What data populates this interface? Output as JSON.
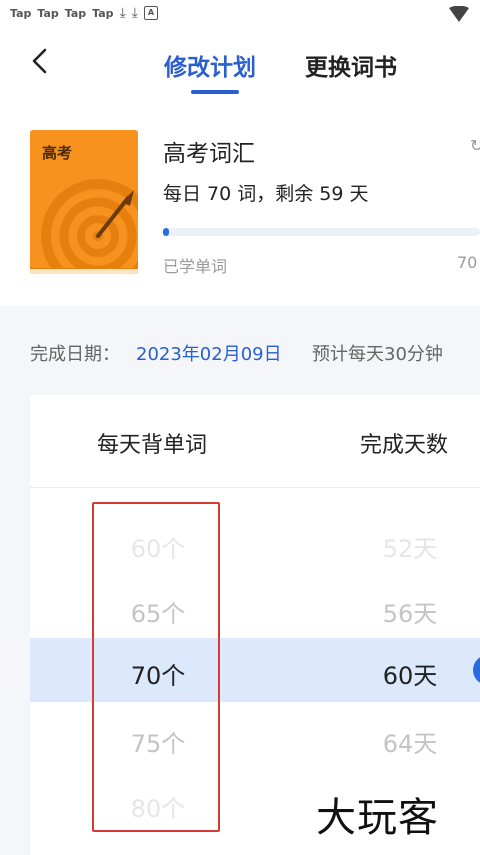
{
  "status_bar": {
    "tap_labels": [
      "Tap",
      "Tap",
      "Tap",
      "Tap"
    ],
    "download_icons": [
      "download-icon",
      "download-icon"
    ],
    "box_icon_letter": "A",
    "signal_icon": "signal-icon"
  },
  "nav": {
    "back_icon": "chevron-left-icon",
    "tab_modify": "修改计划",
    "tab_change": "更换词书",
    "active_color": "#2a5fd0"
  },
  "book": {
    "cover_title": "高考",
    "name": "高考词汇",
    "plan": "每日 70 词，剩余 59 天",
    "progress_fraction": 0.02,
    "learned_label": "已学单词",
    "total": "70",
    "cover_color": "#f7921e"
  },
  "schedule": {
    "complete_date_label": "完成日期：",
    "complete_date": "2023年02月09日",
    "daily_time": "预计每天30分钟"
  },
  "picker": {
    "words_header": "每天背单词",
    "days_header": "完成天数",
    "rows": [
      {
        "words": "60个",
        "days": "52天"
      },
      {
        "words": "65个",
        "days": "56天"
      },
      {
        "words": "70个",
        "days": "60天"
      },
      {
        "words": "75个",
        "days": "64天"
      },
      {
        "words": "80个",
        "days": "..."
      }
    ],
    "selected_index": 2,
    "selected_bg": "#dce8fb"
  },
  "watermark": "大玩客"
}
